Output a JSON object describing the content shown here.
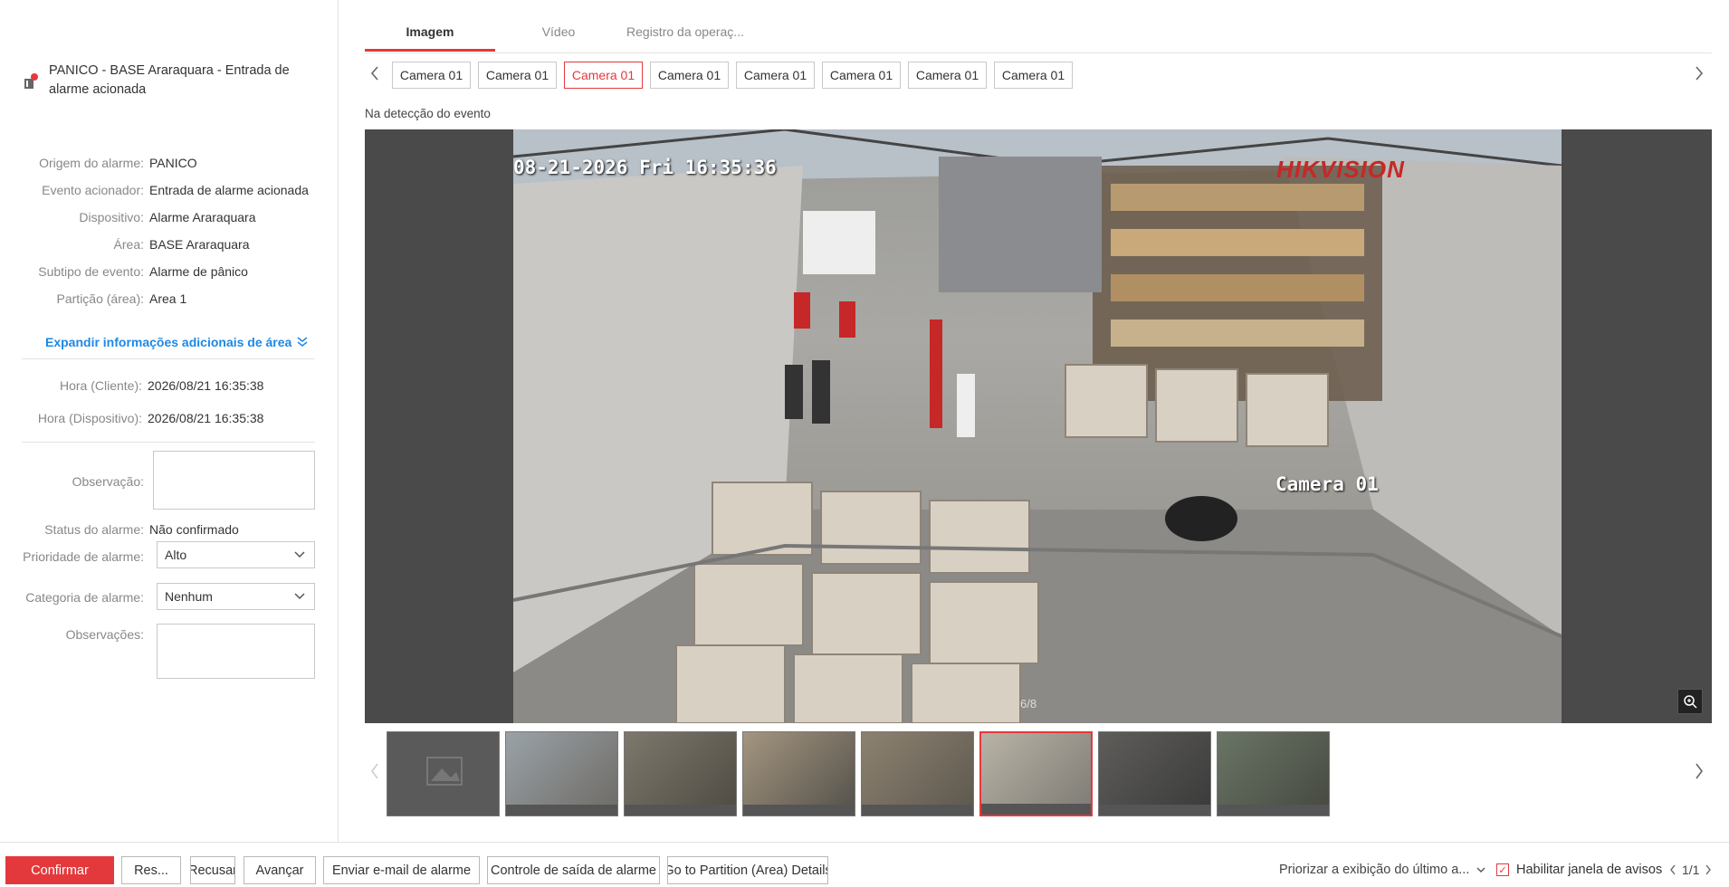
{
  "alarm": {
    "title": "PANICO - BASE Araraquara - Entrada de alarme acionada",
    "details": [
      {
        "label": "Origem do alarme:",
        "value": "PANICO"
      },
      {
        "label": "Evento acionador:",
        "value": "Entrada de alarme acionada"
      },
      {
        "label": "Dispositivo:",
        "value": "Alarme Araraquara"
      },
      {
        "label": "Área:",
        "value": "BASE Araraquara"
      },
      {
        "label": "Subtipo de evento:",
        "value": "Alarme de pânico"
      },
      {
        "label": "Partição (área):",
        "value": "Area 1"
      }
    ],
    "expand_label": "Expandir informações adicionais de área",
    "times": [
      {
        "label": "Hora (Cliente):",
        "value": "2026/08/21 16:35:38"
      },
      {
        "label": "Hora (Dispositivo):",
        "value": "2026/08/21 16:35:38"
      }
    ],
    "observation_label": "Observação:",
    "status_label": "Status do alarme:",
    "status_value": "Não confirmado",
    "priority_label": "Prioridade de alarme:",
    "priority_value": "Alto",
    "category_label": "Categoria de alarme:",
    "category_value": "Nenhum",
    "remarks_label": "Observações:"
  },
  "tabs": [
    {
      "label": "Imagem",
      "active": true
    },
    {
      "label": "Vídeo",
      "active": false
    },
    {
      "label": "Registro da operaç...",
      "active": false
    }
  ],
  "cameras": [
    "Camera 01",
    "Camera 01",
    "Camera 01",
    "Camera 01",
    "Camera 01",
    "Camera 01",
    "Camera 01",
    "Camera 01"
  ],
  "active_camera_index": 2,
  "section_label": "Na detecção do evento",
  "viewer": {
    "timestamp": "08-21-2026 Fri 16:35:36",
    "brand": "HIKVISION",
    "camera_label": "Camera 01",
    "counter": "6/8"
  },
  "thumbnails_active_index": 5,
  "bottom": {
    "confirm": "Confirmar",
    "resolve": "Res...",
    "refuse": "Recusar",
    "forward": "Avançar",
    "email": "Enviar e-mail de alarme",
    "output": "Controle de saída de alarme",
    "partition": "Go to Partition (Area) Details",
    "prioritize": "Priorizar a exibição do último a...",
    "enable_popup": "Habilitar janela de avisos",
    "pager": "1/1"
  },
  "colors": {
    "accent": "#e4393c",
    "link": "#1e88e5"
  }
}
